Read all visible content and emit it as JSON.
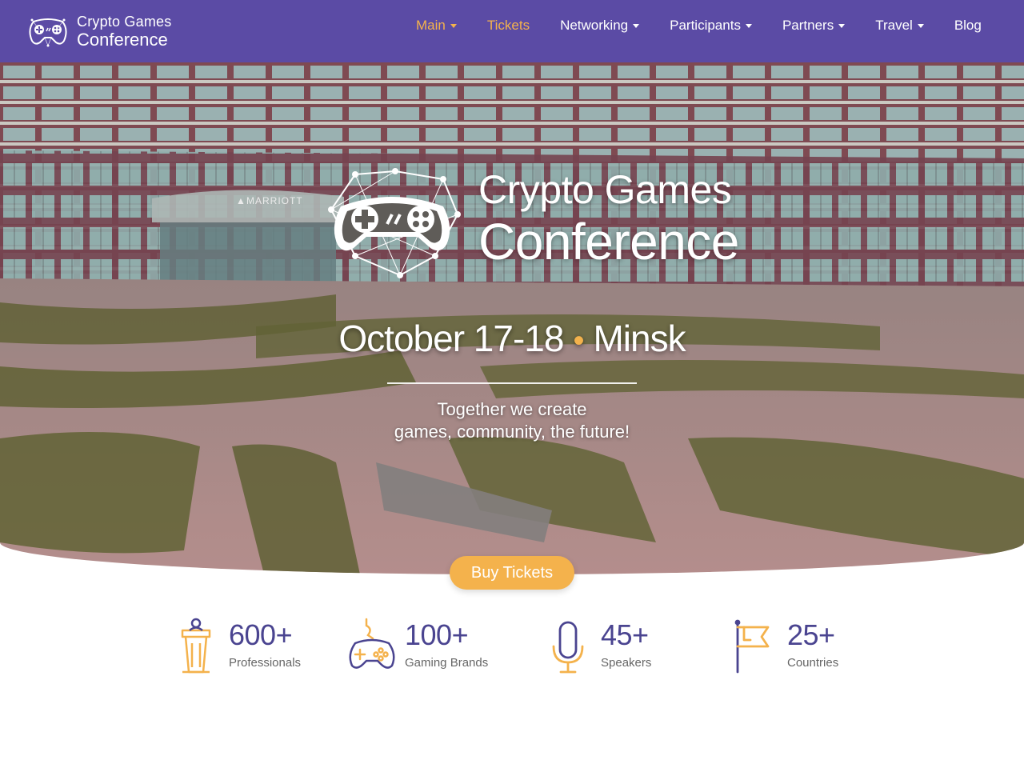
{
  "header": {
    "brand_line1": "Crypto Games",
    "brand_line2": "Conference",
    "nav": [
      {
        "label": "Main",
        "caret": true,
        "active": true
      },
      {
        "label": "Tickets",
        "caret": false
      },
      {
        "label": "Networking",
        "caret": true
      },
      {
        "label": "Participants",
        "caret": true
      },
      {
        "label": "Partners",
        "caret": true
      },
      {
        "label": "Travel",
        "caret": true
      },
      {
        "label": "Blog",
        "caret": false
      }
    ]
  },
  "hero": {
    "title_line1": "Crypto Games",
    "title_line2": "Conference",
    "date": "October 17-18",
    "separator": "•",
    "city": "Minsk",
    "tagline_line1": "Together we create",
    "tagline_line2": "games, community, the future!",
    "background_sign": "MARRIOTT"
  },
  "cta": {
    "buy_label": "Buy Tickets"
  },
  "stats": [
    {
      "value": "600+",
      "label": "Professionals",
      "icon": "podium-icon"
    },
    {
      "value": "100+",
      "label": "Gaming Brands",
      "icon": "gamepad-icon"
    },
    {
      "value": "45+",
      "label": "Speakers",
      "icon": "microphone-icon"
    },
    {
      "value": "25+",
      "label": "Countries",
      "icon": "flag-icon"
    }
  ],
  "colors": {
    "primary": "#5b4ba5",
    "accent": "#f4b24c",
    "stat_number": "#4a4490"
  }
}
